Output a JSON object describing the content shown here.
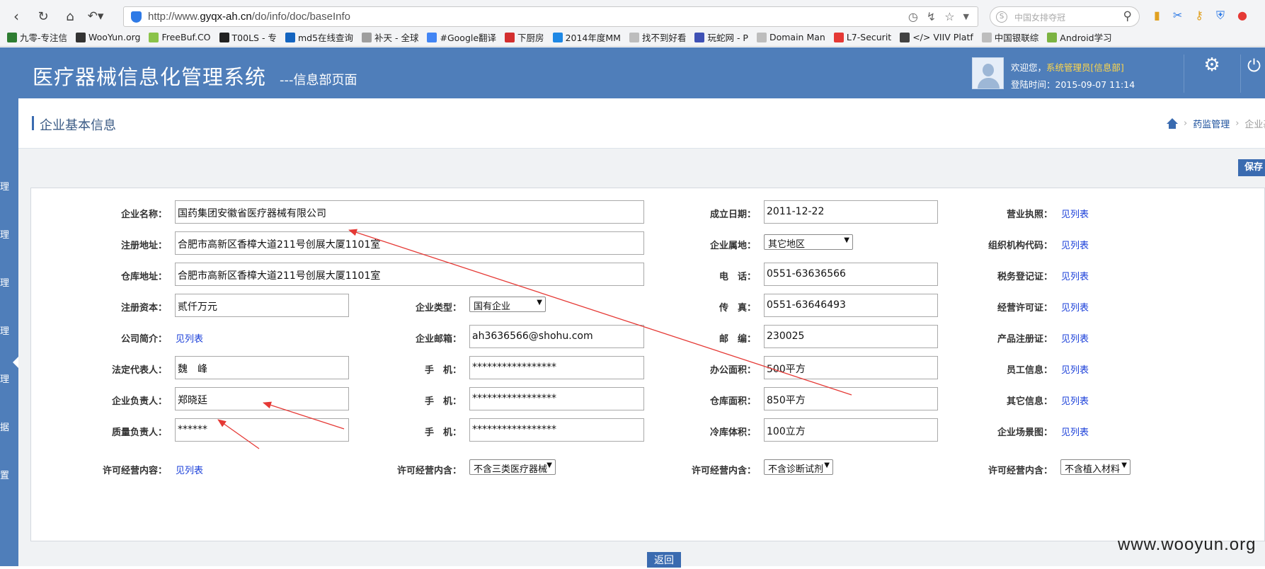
{
  "browser": {
    "url_prefix": "http://www.",
    "url_domain": "gyqx-ah.cn",
    "url_path": "/do/info/doc/baseInfo",
    "search_placeholder": "中国女排夺冠",
    "bookmarks": [
      {
        "label": "九零-专注信",
        "color": "#2e7d32"
      },
      {
        "label": "WooYun.org",
        "color": "#333333"
      },
      {
        "label": "FreeBuf.CO",
        "color": "#8bc34a"
      },
      {
        "label": "T00LS - 专",
        "color": "#222222"
      },
      {
        "label": "md5在线查询",
        "color": "#1565c0"
      },
      {
        "label": "补天 - 全球",
        "color": "#9e9e9e"
      },
      {
        "label": "#Google翻译",
        "color": "#4285f4"
      },
      {
        "label": "下厨房",
        "color": "#d32f2f"
      },
      {
        "label": "2014年度MM",
        "color": "#1e88e5"
      },
      {
        "label": "找不到好看",
        "color": "#bdbdbd"
      },
      {
        "label": "玩蛇网 - P",
        "color": "#3f51b5"
      },
      {
        "label": "Domain Man",
        "color": "#bdbdbd"
      },
      {
        "label": "L7-Securit",
        "color": "#e53935"
      },
      {
        "label": "</> VIIV Platf",
        "color": "#424242"
      },
      {
        "label": "中国银联综",
        "color": "#bdbdbd"
      },
      {
        "label": "Android学习",
        "color": "#7cb342"
      }
    ]
  },
  "header": {
    "title": "医疗器械信息化管理系统",
    "subtitle": "---信息部页面",
    "welcome_prefix": "欢迎您，",
    "welcome_user": "系统管理员[信息部]",
    "login_time": "登陆时间：2015-09-07 11:14",
    "settings_label": "设置"
  },
  "sidebar": {
    "items": [
      "理",
      "理",
      "理",
      "理",
      "理",
      "据",
      "置"
    ]
  },
  "page": {
    "title": "企业基本信息",
    "breadcrumb_link": "药监管理",
    "breadcrumb_current": "企业基",
    "save_label": "保存",
    "return_label": "返回"
  },
  "form": {
    "company_name_label": "企业名称：",
    "company_name": "国药集团安徽省医疗器械有限公司",
    "reg_address_label": "注册地址：",
    "reg_address": "合肥市高新区香樟大道211号创展大厦1101室",
    "warehouse_address_label": "仓库地址：",
    "warehouse_address": "合肥市高新区香樟大道211号创展大厦1101室",
    "reg_capital_label": "注册资本：",
    "reg_capital": "贰仟万元",
    "company_type_label": "企业类型：",
    "company_type": "国有企业",
    "intro_label": "公司简介：",
    "intro_link": "见列表",
    "email_label": "企业邮箱：",
    "email": "ah3636566@shohu.com",
    "legal_rep_label": "法定代表人：",
    "legal_rep": "魏　峰",
    "mobile_label": "手　机：",
    "mobile_1": "*****************",
    "responsible_label": "企业负责人：",
    "responsible": "郑晓廷",
    "mobile_2": "*****************",
    "quality_label": "质量负责人：",
    "quality": "******",
    "mobile_3": "*****************",
    "license_content_label": "许可经营内容：",
    "license_content_link": "见列表",
    "license_include_label": "许可经营内含：",
    "license_include_1": "不含三类医疗器械",
    "license_include_2": "不含诊断试剂",
    "license_include_3": "不含植入材料",
    "found_date_label": "成立日期：",
    "found_date": "2011-12-22",
    "region_label": "企业属地：",
    "region": "其它地区",
    "phone_label": "电　话：",
    "phone": "0551-63636566",
    "fax_label": "传　真：",
    "fax": "0551-63646493",
    "postcode_label": "邮　编：",
    "postcode": "230025",
    "office_area_label": "办公面积：",
    "office_area": "500平方",
    "warehouse_area_label": "仓库面积：",
    "warehouse_area": "850平方",
    "cold_storage_label": "冷库体积：",
    "cold_storage": "100立方",
    "doc_links": [
      {
        "label": "营业执照：",
        "link": "见列表"
      },
      {
        "label": "组织机构代码：",
        "link": "见列表"
      },
      {
        "label": "税务登记证：",
        "link": "见列表"
      },
      {
        "label": "经营许可证：",
        "link": "见列表"
      },
      {
        "label": "产品注册证：",
        "link": "见列表"
      },
      {
        "label": "员工信息：",
        "link": "见列表"
      },
      {
        "label": "其它信息：",
        "link": "见列表"
      },
      {
        "label": "企业场景图：",
        "link": "见列表"
      }
    ]
  },
  "watermark": "www.wooyun.org",
  "colors": {
    "header_bg": "#4f7eba",
    "link": "#1a3fd9",
    "annotation_arrow": "#e53935"
  }
}
